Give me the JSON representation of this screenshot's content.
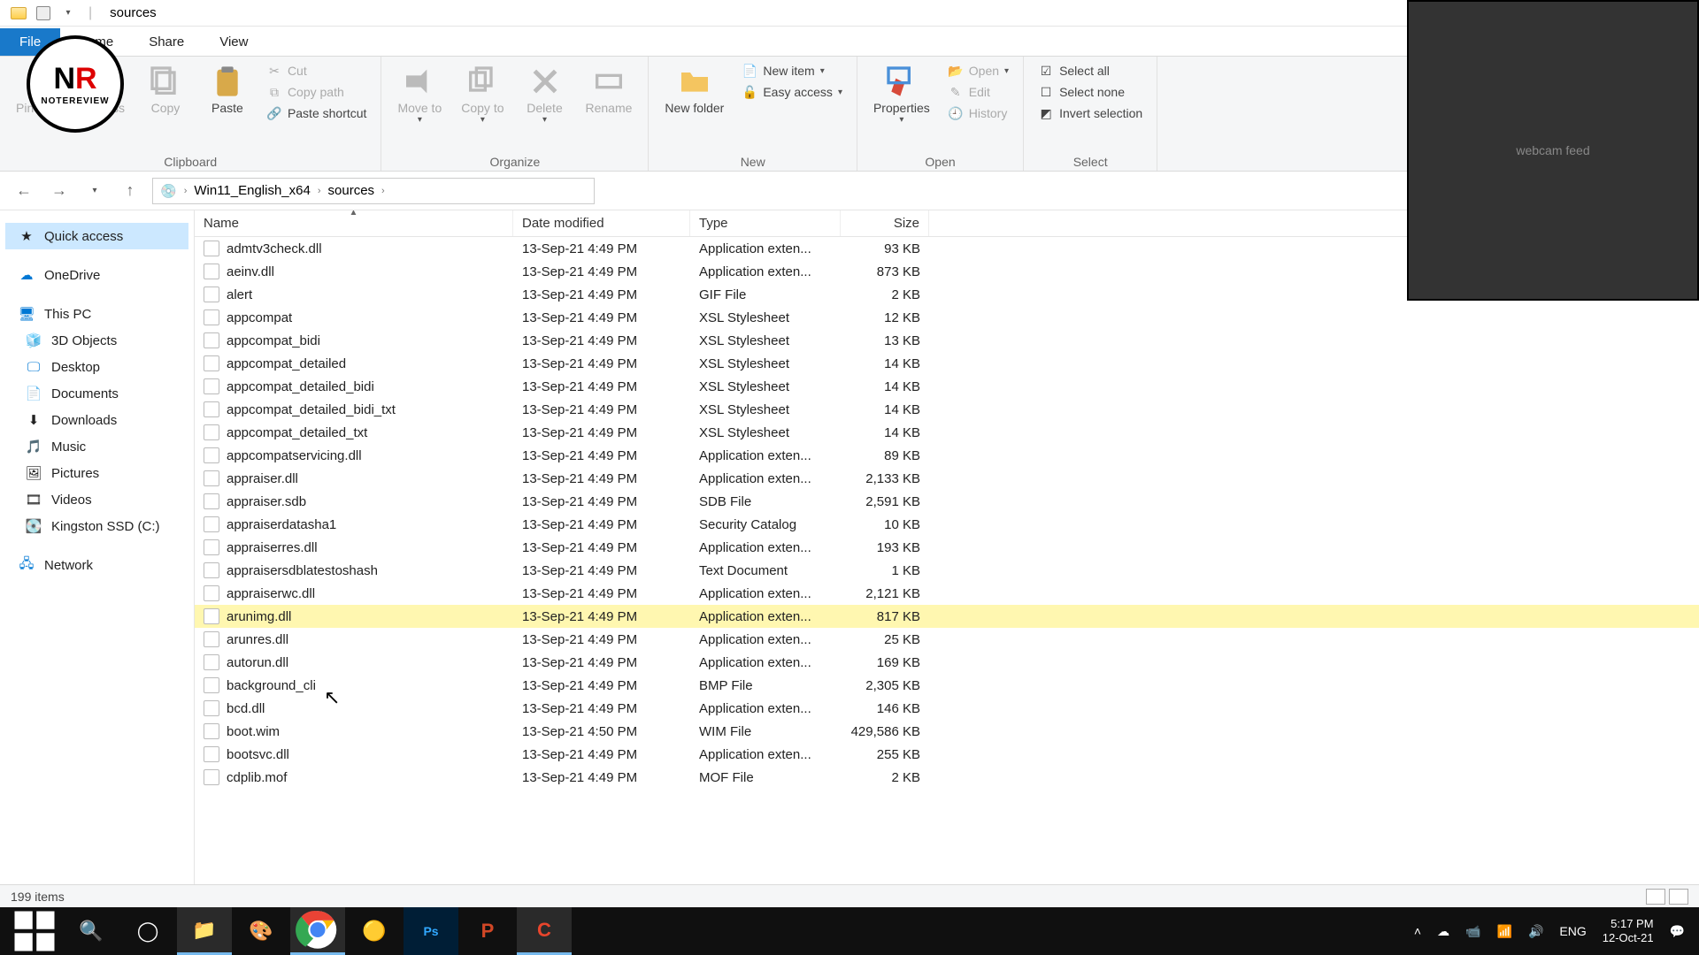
{
  "window": {
    "title": "sources"
  },
  "tabs": {
    "file": "File",
    "home": "Home",
    "share": "Share",
    "view": "View"
  },
  "ribbon": {
    "clipboard": {
      "title": "Clipboard",
      "pin": "Pin to Quick access",
      "copy": "Copy",
      "paste": "Paste",
      "cut": "Cut",
      "copypath": "Copy path",
      "pasteshortcut": "Paste shortcut"
    },
    "organize": {
      "title": "Organize",
      "moveto": "Move to",
      "copyto": "Copy to",
      "delete": "Delete",
      "rename": "Rename"
    },
    "new": {
      "title": "New",
      "newfolder": "New folder",
      "newitem": "New item",
      "easyaccess": "Easy access"
    },
    "open": {
      "title": "Open",
      "properties": "Properties",
      "open": "Open",
      "edit": "Edit",
      "history": "History"
    },
    "select": {
      "title": "Select",
      "selectall": "Select all",
      "selectnone": "Select none",
      "invert": "Invert selection"
    }
  },
  "breadcrumb": {
    "root": "Win11_English_x64",
    "current": "sources"
  },
  "sidebar": {
    "quick": "Quick access",
    "onedrive": "OneDrive",
    "thispc": "This PC",
    "objects3d": "3D Objects",
    "desktop": "Desktop",
    "documents": "Documents",
    "downloads": "Downloads",
    "music": "Music",
    "pictures": "Pictures",
    "videos": "Videos",
    "drive": "Kingston SSD (C:)",
    "network": "Network"
  },
  "columns": {
    "name": "Name",
    "date": "Date modified",
    "type": "Type",
    "size": "Size"
  },
  "files": [
    {
      "name": "admtv3check.dll",
      "date": "13-Sep-21 4:49 PM",
      "type": "Application exten...",
      "size": "93 KB"
    },
    {
      "name": "aeinv.dll",
      "date": "13-Sep-21 4:49 PM",
      "type": "Application exten...",
      "size": "873 KB"
    },
    {
      "name": "alert",
      "date": "13-Sep-21 4:49 PM",
      "type": "GIF File",
      "size": "2 KB"
    },
    {
      "name": "appcompat",
      "date": "13-Sep-21 4:49 PM",
      "type": "XSL Stylesheet",
      "size": "12 KB"
    },
    {
      "name": "appcompat_bidi",
      "date": "13-Sep-21 4:49 PM",
      "type": "XSL Stylesheet",
      "size": "13 KB"
    },
    {
      "name": "appcompat_detailed",
      "date": "13-Sep-21 4:49 PM",
      "type": "XSL Stylesheet",
      "size": "14 KB"
    },
    {
      "name": "appcompat_detailed_bidi",
      "date": "13-Sep-21 4:49 PM",
      "type": "XSL Stylesheet",
      "size": "14 KB"
    },
    {
      "name": "appcompat_detailed_bidi_txt",
      "date": "13-Sep-21 4:49 PM",
      "type": "XSL Stylesheet",
      "size": "14 KB"
    },
    {
      "name": "appcompat_detailed_txt",
      "date": "13-Sep-21 4:49 PM",
      "type": "XSL Stylesheet",
      "size": "14 KB"
    },
    {
      "name": "appcompatservicing.dll",
      "date": "13-Sep-21 4:49 PM",
      "type": "Application exten...",
      "size": "89 KB"
    },
    {
      "name": "appraiser.dll",
      "date": "13-Sep-21 4:49 PM",
      "type": "Application exten...",
      "size": "2,133 KB"
    },
    {
      "name": "appraiser.sdb",
      "date": "13-Sep-21 4:49 PM",
      "type": "SDB File",
      "size": "2,591 KB"
    },
    {
      "name": "appraiserdatasha1",
      "date": "13-Sep-21 4:49 PM",
      "type": "Security Catalog",
      "size": "10 KB"
    },
    {
      "name": "appraiserres.dll",
      "date": "13-Sep-21 4:49 PM",
      "type": "Application exten...",
      "size": "193 KB"
    },
    {
      "name": "appraisersdblatestoshash",
      "date": "13-Sep-21 4:49 PM",
      "type": "Text Document",
      "size": "1 KB"
    },
    {
      "name": "appraiserwc.dll",
      "date": "13-Sep-21 4:49 PM",
      "type": "Application exten...",
      "size": "2,121 KB"
    },
    {
      "name": "arunimg.dll",
      "date": "13-Sep-21 4:49 PM",
      "type": "Application exten...",
      "size": "817 KB",
      "hl": true
    },
    {
      "name": "arunres.dll",
      "date": "13-Sep-21 4:49 PM",
      "type": "Application exten...",
      "size": "25 KB"
    },
    {
      "name": "autorun.dll",
      "date": "13-Sep-21 4:49 PM",
      "type": "Application exten...",
      "size": "169 KB"
    },
    {
      "name": "background_cli",
      "date": "13-Sep-21 4:49 PM",
      "type": "BMP File",
      "size": "2,305 KB"
    },
    {
      "name": "bcd.dll",
      "date": "13-Sep-21 4:49 PM",
      "type": "Application exten...",
      "size": "146 KB"
    },
    {
      "name": "boot.wim",
      "date": "13-Sep-21 4:50 PM",
      "type": "WIM File",
      "size": "429,586 KB"
    },
    {
      "name": "bootsvc.dll",
      "date": "13-Sep-21 4:49 PM",
      "type": "Application exten...",
      "size": "255 KB"
    },
    {
      "name": "cdplib.mof",
      "date": "13-Sep-21 4:49 PM",
      "type": "MOF File",
      "size": "2 KB"
    }
  ],
  "status": {
    "count": "199 items"
  },
  "tray": {
    "lang": "ENG",
    "time": "5:17 PM",
    "date": "12-Oct-21"
  },
  "logo": {
    "big": "NR",
    "sub": "NOTEREVIEW"
  },
  "webcam": {
    "label": "webcam feed"
  }
}
